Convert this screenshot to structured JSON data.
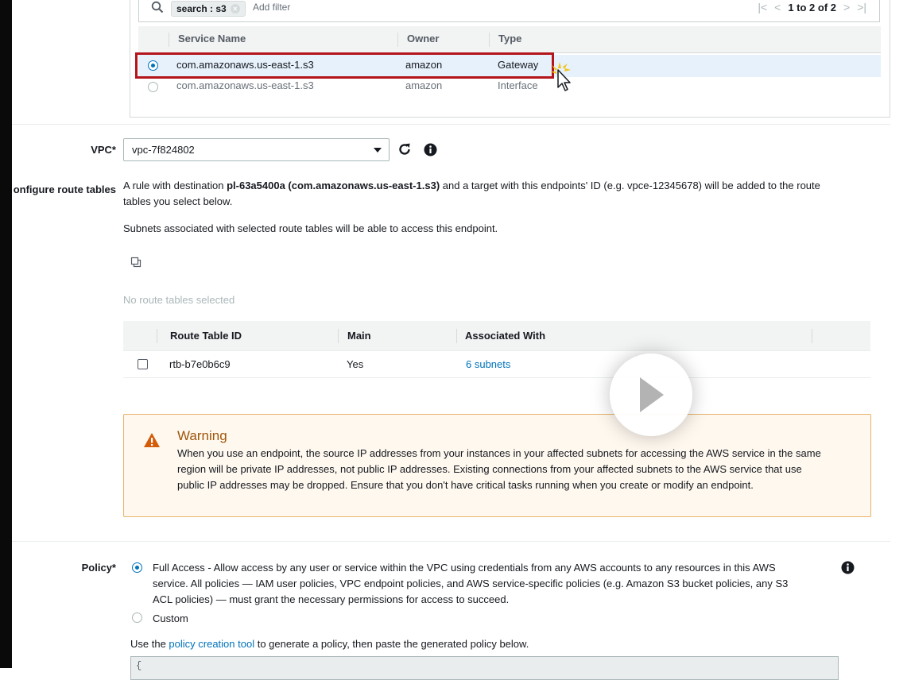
{
  "filter": {
    "token": "search : s3",
    "add_filter_placeholder": "Add filter",
    "pagination": "1 to 2 of 2"
  },
  "service_table": {
    "columns": [
      "Service Name",
      "Owner",
      "Type"
    ],
    "rows": [
      {
        "service_name": "com.amazonaws.us-east-1.s3",
        "owner": "amazon",
        "type": "Gateway",
        "selected": true
      },
      {
        "service_name": "com.amazonaws.us-east-1.s3",
        "owner": "amazon",
        "type": "Interface",
        "selected": false
      }
    ]
  },
  "vpc": {
    "label": "VPC*",
    "value": "vpc-7f824802"
  },
  "route_tables": {
    "label": "onfigure route tables",
    "rule_prefix": "A rule with destination ",
    "rule_destination": "pl-63a5400a (com.amazonaws.us-east-1.s3)",
    "rule_suffix": " and a target with this endpoints' ID (e.g. vpce-12345678) will be added to the route",
    "rule_line2": "tables you select below.",
    "subnets_note": "Subnets associated with selected route tables will be able to access this endpoint.",
    "empty_state": "No route tables selected",
    "columns": [
      "Route Table ID",
      "Main",
      "Associated With"
    ],
    "rows": [
      {
        "id": "rtb-b7e0b6c9",
        "main": "Yes",
        "associated_with": "6 subnets"
      }
    ]
  },
  "warning": {
    "title": "Warning",
    "lines": [
      "When you use an endpoint, the source IP addresses from your instances in your affected subnets for accessing the AWS service in the same",
      "region will be private IP addresses, not public IP addresses. Existing connections from your affected subnets to the AWS service that use",
      "public IP addresses may be dropped. Ensure that you don't have critical tasks running when you create or modify an endpoint."
    ]
  },
  "policy": {
    "label": "Policy*",
    "full_access_lines": [
      "Full Access - Allow access by any user or service within the VPC using credentials from any AWS accounts to any resources in this AWS",
      "service. All policies — IAM user policies, VPC endpoint policies, and AWS service-specific policies (e.g. Amazon S3 bucket policies, any S3",
      "ACL policies) — must grant the necessary permissions for access to succeed."
    ],
    "custom_label": "Custom",
    "tool_prefix": "Use the ",
    "tool_link": "policy creation tool",
    "tool_suffix": " to generate a policy, then paste the generated policy below.",
    "editor_text": "{"
  },
  "colors": {
    "aws_link": "#0073bb",
    "selected_row": "#e7f1fb",
    "highlight_border": "#b3151b",
    "warning_bg": "#fef8ef",
    "warning_title": "#a0550a"
  }
}
